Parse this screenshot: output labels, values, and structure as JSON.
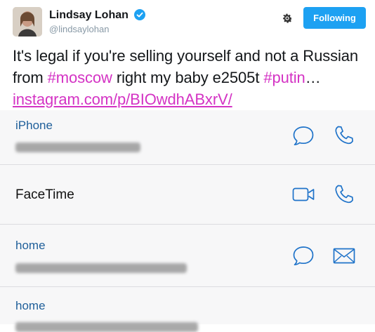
{
  "colors": {
    "accent": "#1da1f2",
    "hashtag": "#d433c4",
    "contact_label": "#1f5f9a",
    "ios_icon": "#1f73c9"
  },
  "tweet": {
    "display_name": "Lindsay Lohan",
    "handle": "@lindsaylohan",
    "follow_button": "Following",
    "text": {
      "part1": "It's legal if you're selling yourself and not a Russian from ",
      "hashtag1": "#moscow",
      "part2": " right my baby e2505t ",
      "hashtag2": "#putin",
      "ellipsis": "… ",
      "link": "instagram.com/p/BIOwdhABxrV/"
    },
    "icons": [
      "verified-badge-icon",
      "gear-icon"
    ]
  },
  "contacts": {
    "rows": [
      {
        "label": "iPhone",
        "value": "",
        "actions": [
          "message-icon",
          "phone-icon"
        ]
      },
      {
        "label": "FaceTime",
        "actions": [
          "video-icon",
          "phone-icon"
        ]
      },
      {
        "label": "home",
        "value": "",
        "actions": [
          "message-icon",
          "mail-icon"
        ]
      },
      {
        "label": "home"
      }
    ]
  }
}
